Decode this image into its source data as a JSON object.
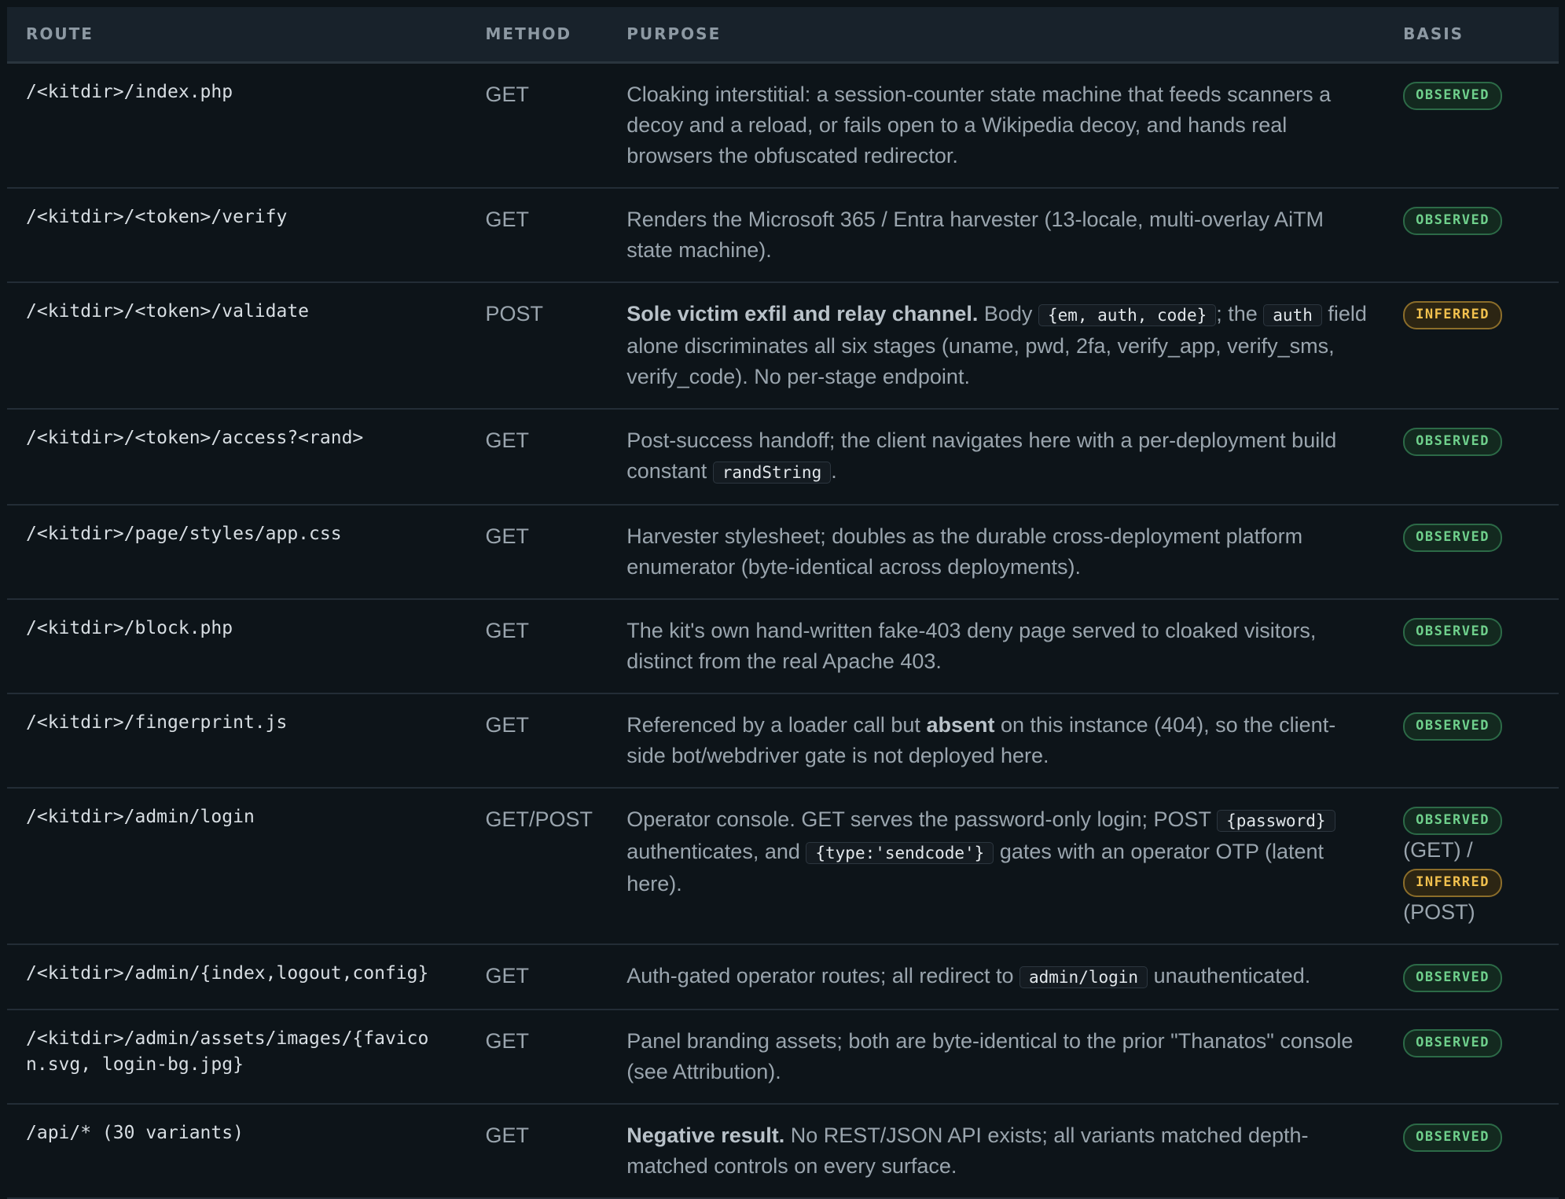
{
  "columns": {
    "route": "ROUTE",
    "method": "METHOD",
    "purpose": "PURPOSE",
    "basis": "BASIS"
  },
  "rows": [
    {
      "route": "/<kitdir>/index.php",
      "method": "GET",
      "purpose": [
        {
          "t": "text",
          "v": "Cloaking interstitial: a session-counter state machine that feeds scanners a decoy and a reload, or fails open to a Wikipedia decoy, and hands real browsers the obfuscated redirector."
        }
      ],
      "basis": [
        {
          "t": "badge",
          "v": "OBSERVED",
          "kind": "observed"
        }
      ]
    },
    {
      "route": "/<kitdir>/<token>/verify",
      "method": "GET",
      "purpose": [
        {
          "t": "text",
          "v": "Renders the Microsoft 365 / Entra harvester (13-locale, multi-overlay AiTM state machine)."
        }
      ],
      "basis": [
        {
          "t": "badge",
          "v": "OBSERVED",
          "kind": "observed"
        }
      ]
    },
    {
      "route": "/<kitdir>/<token>/validate",
      "method": "POST",
      "purpose": [
        {
          "t": "bold",
          "v": "Sole victim exfil and relay channel."
        },
        {
          "t": "text",
          "v": " Body "
        },
        {
          "t": "code",
          "v": "{em, auth, code}"
        },
        {
          "t": "text",
          "v": "; the "
        },
        {
          "t": "code",
          "v": "auth"
        },
        {
          "t": "text",
          "v": " field alone discriminates all six stages (uname, pwd, 2fa, verify_app, verify_sms, verify_code). No per-stage endpoint."
        }
      ],
      "basis": [
        {
          "t": "badge",
          "v": "INFERRED",
          "kind": "inferred"
        }
      ]
    },
    {
      "route": "/<kitdir>/<token>/access?<rand>",
      "method": "GET",
      "purpose": [
        {
          "t": "text",
          "v": "Post-success handoff; the client navigates here with a per-deployment build constant "
        },
        {
          "t": "code",
          "v": "randString"
        },
        {
          "t": "text",
          "v": "."
        }
      ],
      "basis": [
        {
          "t": "badge",
          "v": "OBSERVED",
          "kind": "observed"
        }
      ]
    },
    {
      "route": "/<kitdir>/page/styles/app.css",
      "method": "GET",
      "purpose": [
        {
          "t": "text",
          "v": "Harvester stylesheet; doubles as the durable cross-deployment platform enumerator (byte-identical across deployments)."
        }
      ],
      "basis": [
        {
          "t": "badge",
          "v": "OBSERVED",
          "kind": "observed"
        }
      ]
    },
    {
      "route": "/<kitdir>/block.php",
      "method": "GET",
      "purpose": [
        {
          "t": "text",
          "v": "The kit's own hand-written fake-403 deny page served to cloaked visitors, distinct from the real Apache 403."
        }
      ],
      "basis": [
        {
          "t": "badge",
          "v": "OBSERVED",
          "kind": "observed"
        }
      ]
    },
    {
      "route": "/<kitdir>/fingerprint.js",
      "method": "GET",
      "purpose": [
        {
          "t": "text",
          "v": "Referenced by a loader call but "
        },
        {
          "t": "bold",
          "v": "absent"
        },
        {
          "t": "text",
          "v": " on this instance (404), so the client-side bot/webdriver gate is not deployed here."
        }
      ],
      "basis": [
        {
          "t": "badge",
          "v": "OBSERVED",
          "kind": "observed"
        }
      ]
    },
    {
      "route": "/<kitdir>/admin/login",
      "method": "GET/POST",
      "purpose": [
        {
          "t": "text",
          "v": "Operator console. GET serves the password-only login; POST "
        },
        {
          "t": "code",
          "v": "{password}"
        },
        {
          "t": "text",
          "v": " authenticates, and "
        },
        {
          "t": "code",
          "v": "{type:'sendcode'}"
        },
        {
          "t": "text",
          "v": " gates with an operator OTP (latent here)."
        }
      ],
      "basis": [
        {
          "t": "badge",
          "v": "OBSERVED",
          "kind": "observed"
        },
        {
          "t": "text",
          "v": "(GET) /"
        },
        {
          "t": "badge",
          "v": "INFERRED",
          "kind": "inferred"
        },
        {
          "t": "text",
          "v": "(POST)"
        }
      ]
    },
    {
      "route": "/<kitdir>/admin/{index,logout,config}",
      "method": "GET",
      "purpose": [
        {
          "t": "text",
          "v": "Auth-gated operator routes; all redirect to "
        },
        {
          "t": "code",
          "v": "admin/login"
        },
        {
          "t": "text",
          "v": " unauthenticated."
        }
      ],
      "basis": [
        {
          "t": "badge",
          "v": "OBSERVED",
          "kind": "observed"
        }
      ]
    },
    {
      "route": "/<kitdir>/admin/assets/images/{favicon.svg, login-bg.jpg}",
      "method": "GET",
      "purpose": [
        {
          "t": "text",
          "v": "Panel branding assets; both are byte-identical to the prior \"Thanatos\" console (see Attribution)."
        }
      ],
      "basis": [
        {
          "t": "badge",
          "v": "OBSERVED",
          "kind": "observed"
        }
      ]
    },
    {
      "route": "/api/* (30 variants)",
      "method": "GET",
      "purpose": [
        {
          "t": "bold",
          "v": "Negative result."
        },
        {
          "t": "text",
          "v": " No REST/JSON API exists; all variants matched depth-matched controls on every surface."
        }
      ],
      "basis": [
        {
          "t": "badge",
          "v": "OBSERVED",
          "kind": "observed"
        }
      ]
    }
  ]
}
